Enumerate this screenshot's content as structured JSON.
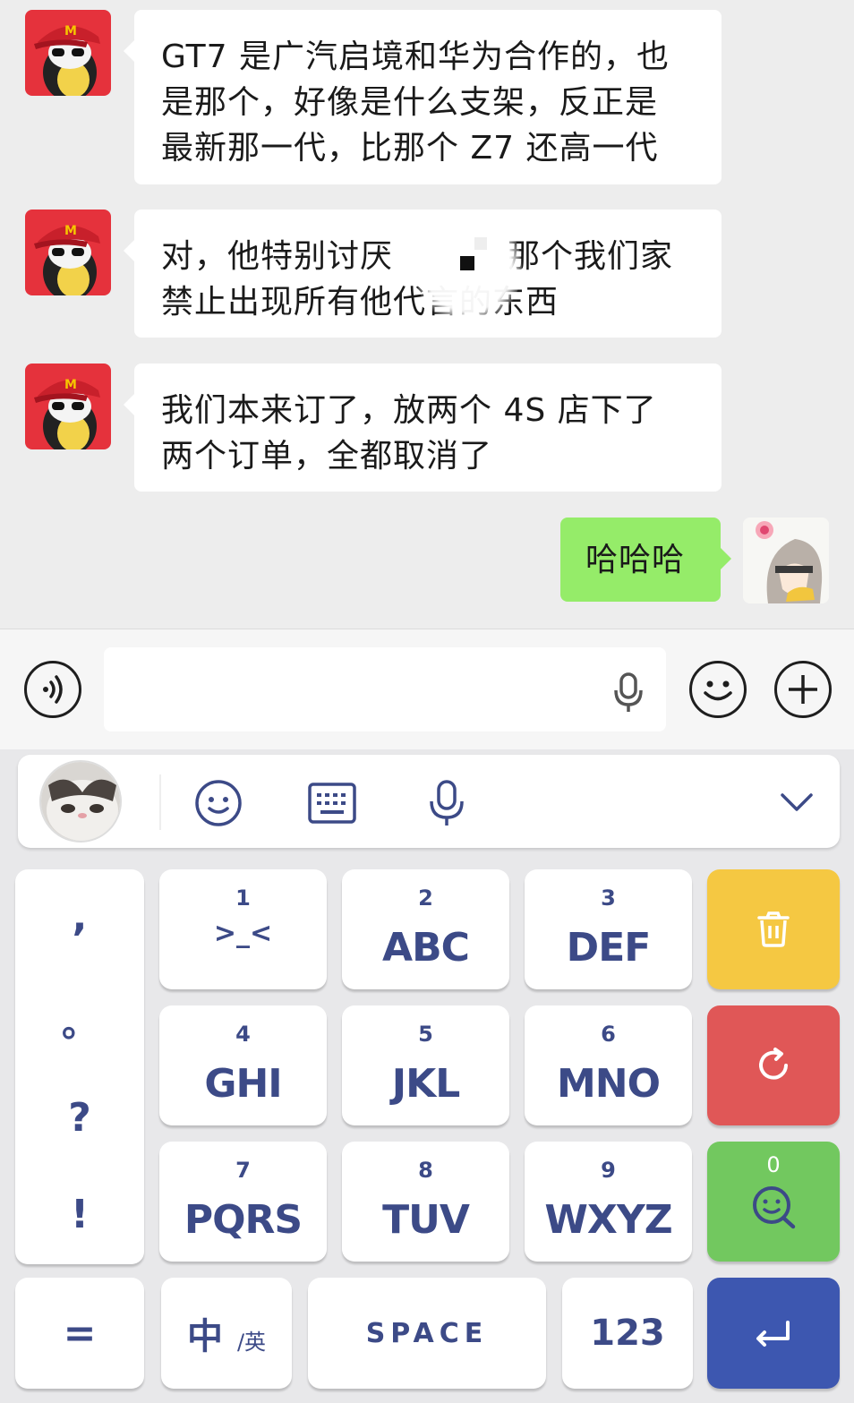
{
  "chat": {
    "messages": [
      {
        "sender": "other",
        "line1": "GT7 是广汽启境和华为合作的，也",
        "line2": "是那个，好像是什么支架，反正是",
        "line3": "最新那一代，比那个 Z7 还高一代"
      },
      {
        "sender": "other",
        "line1": "对，他特别讨厌",
        "line1b": "那个我们家",
        "line2": "禁止出现所有他代言的东西"
      },
      {
        "sender": "other",
        "line1": "我们本来订了，放两个 4S 店下了",
        "line2": "两个订单，全都取消了"
      },
      {
        "sender": "me",
        "text": "哈哈哈"
      }
    ]
  },
  "input_bar": {
    "voice_icon": "voice-wave-icon",
    "mic_icon": "microphone-icon",
    "emoji_icon": "smiley-icon",
    "more_icon": "plus-icon"
  },
  "keyboard": {
    "toolbar_icons": [
      "smiley-icon",
      "keyboard-icon",
      "microphone-icon",
      "chevron-down-icon"
    ],
    "punctuation": [
      ",",
      "。",
      "?",
      "!"
    ],
    "keys": [
      {
        "num": "1",
        "label": ">_<"
      },
      {
        "num": "2",
        "label": "ABC"
      },
      {
        "num": "3",
        "label": "DEF"
      },
      {
        "num": "4",
        "label": "GHI"
      },
      {
        "num": "5",
        "label": "JKL"
      },
      {
        "num": "6",
        "label": "MNO"
      },
      {
        "num": "7",
        "label": "PQRS"
      },
      {
        "num": "8",
        "label": "TUV"
      },
      {
        "num": "9",
        "label": "WXYZ"
      }
    ],
    "zero_label": "0",
    "bottom": {
      "equals": "=",
      "lang_main": "中",
      "lang_sub": "/英",
      "space": "SPACE",
      "num_mode": "123"
    },
    "colors": {
      "key_text": "#3c4a87",
      "delete": "#f5c842",
      "reset": "#e05757",
      "emoji": "#72c85f",
      "enter": "#3d57b0"
    }
  }
}
